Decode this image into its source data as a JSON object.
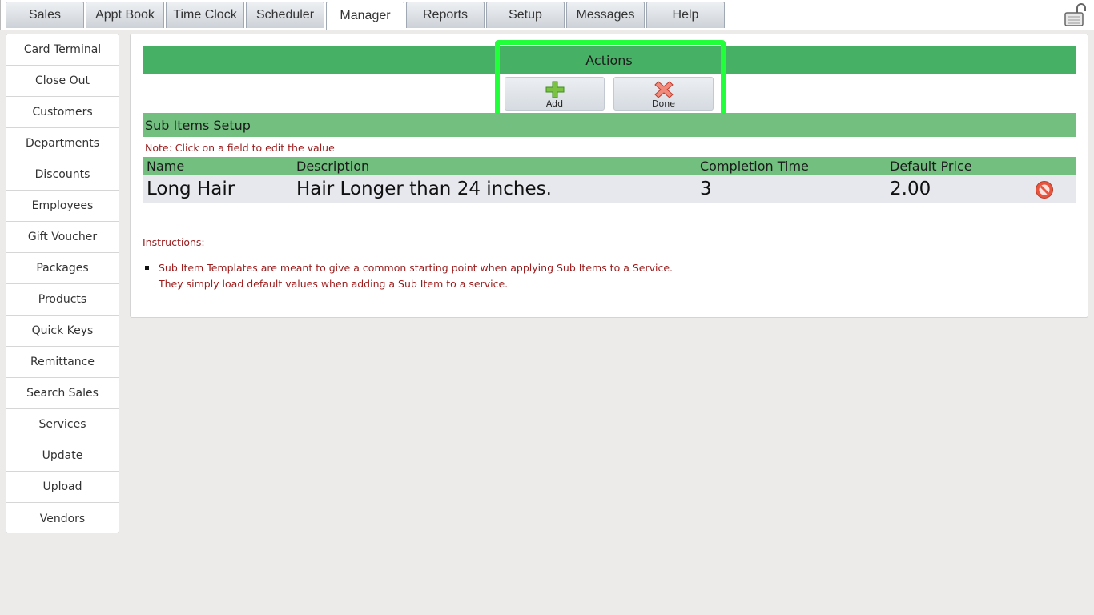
{
  "tabs": [
    "Sales",
    "Appt Book",
    "Time Clock",
    "Scheduler",
    "Manager",
    "Reports",
    "Setup",
    "Messages",
    "Help"
  ],
  "active_tab": "Manager",
  "sidebar": {
    "items": [
      "Card Terminal",
      "Close Out",
      "Customers",
      "Departments",
      "Discounts",
      "Employees",
      "Gift Voucher",
      "Packages",
      "Products",
      "Quick Keys",
      "Remittance",
      "Search Sales",
      "Services",
      "Update",
      "Upload",
      "Vendors"
    ]
  },
  "actions": {
    "title": "Actions",
    "add_label": "Add",
    "done_label": "Done"
  },
  "section": {
    "title": "Sub Items Setup",
    "note": "Note: Click on a field to edit the value"
  },
  "table": {
    "headers": [
      "Name",
      "Description",
      "Completion Time",
      "Default Price"
    ],
    "rows": [
      [
        "Long Hair",
        "Hair Longer than 24 inches.",
        "3",
        "2.00"
      ]
    ]
  },
  "instructions": {
    "title": "Instructions:",
    "line1": "Sub Item Templates are meant to give a common starting point when applying Sub Items to a Service.",
    "line2": "They simply load default values when adding a Sub Item to a service."
  },
  "colors": {
    "header_green": "#46b065",
    "section_green": "#72bf80",
    "highlight": "#21ff3b",
    "note_red": "#9b1c1c"
  },
  "icons": {
    "lock": "unlock-icon",
    "add": "plus-icon",
    "done": "close-icon",
    "delete": "delete-icon"
  }
}
